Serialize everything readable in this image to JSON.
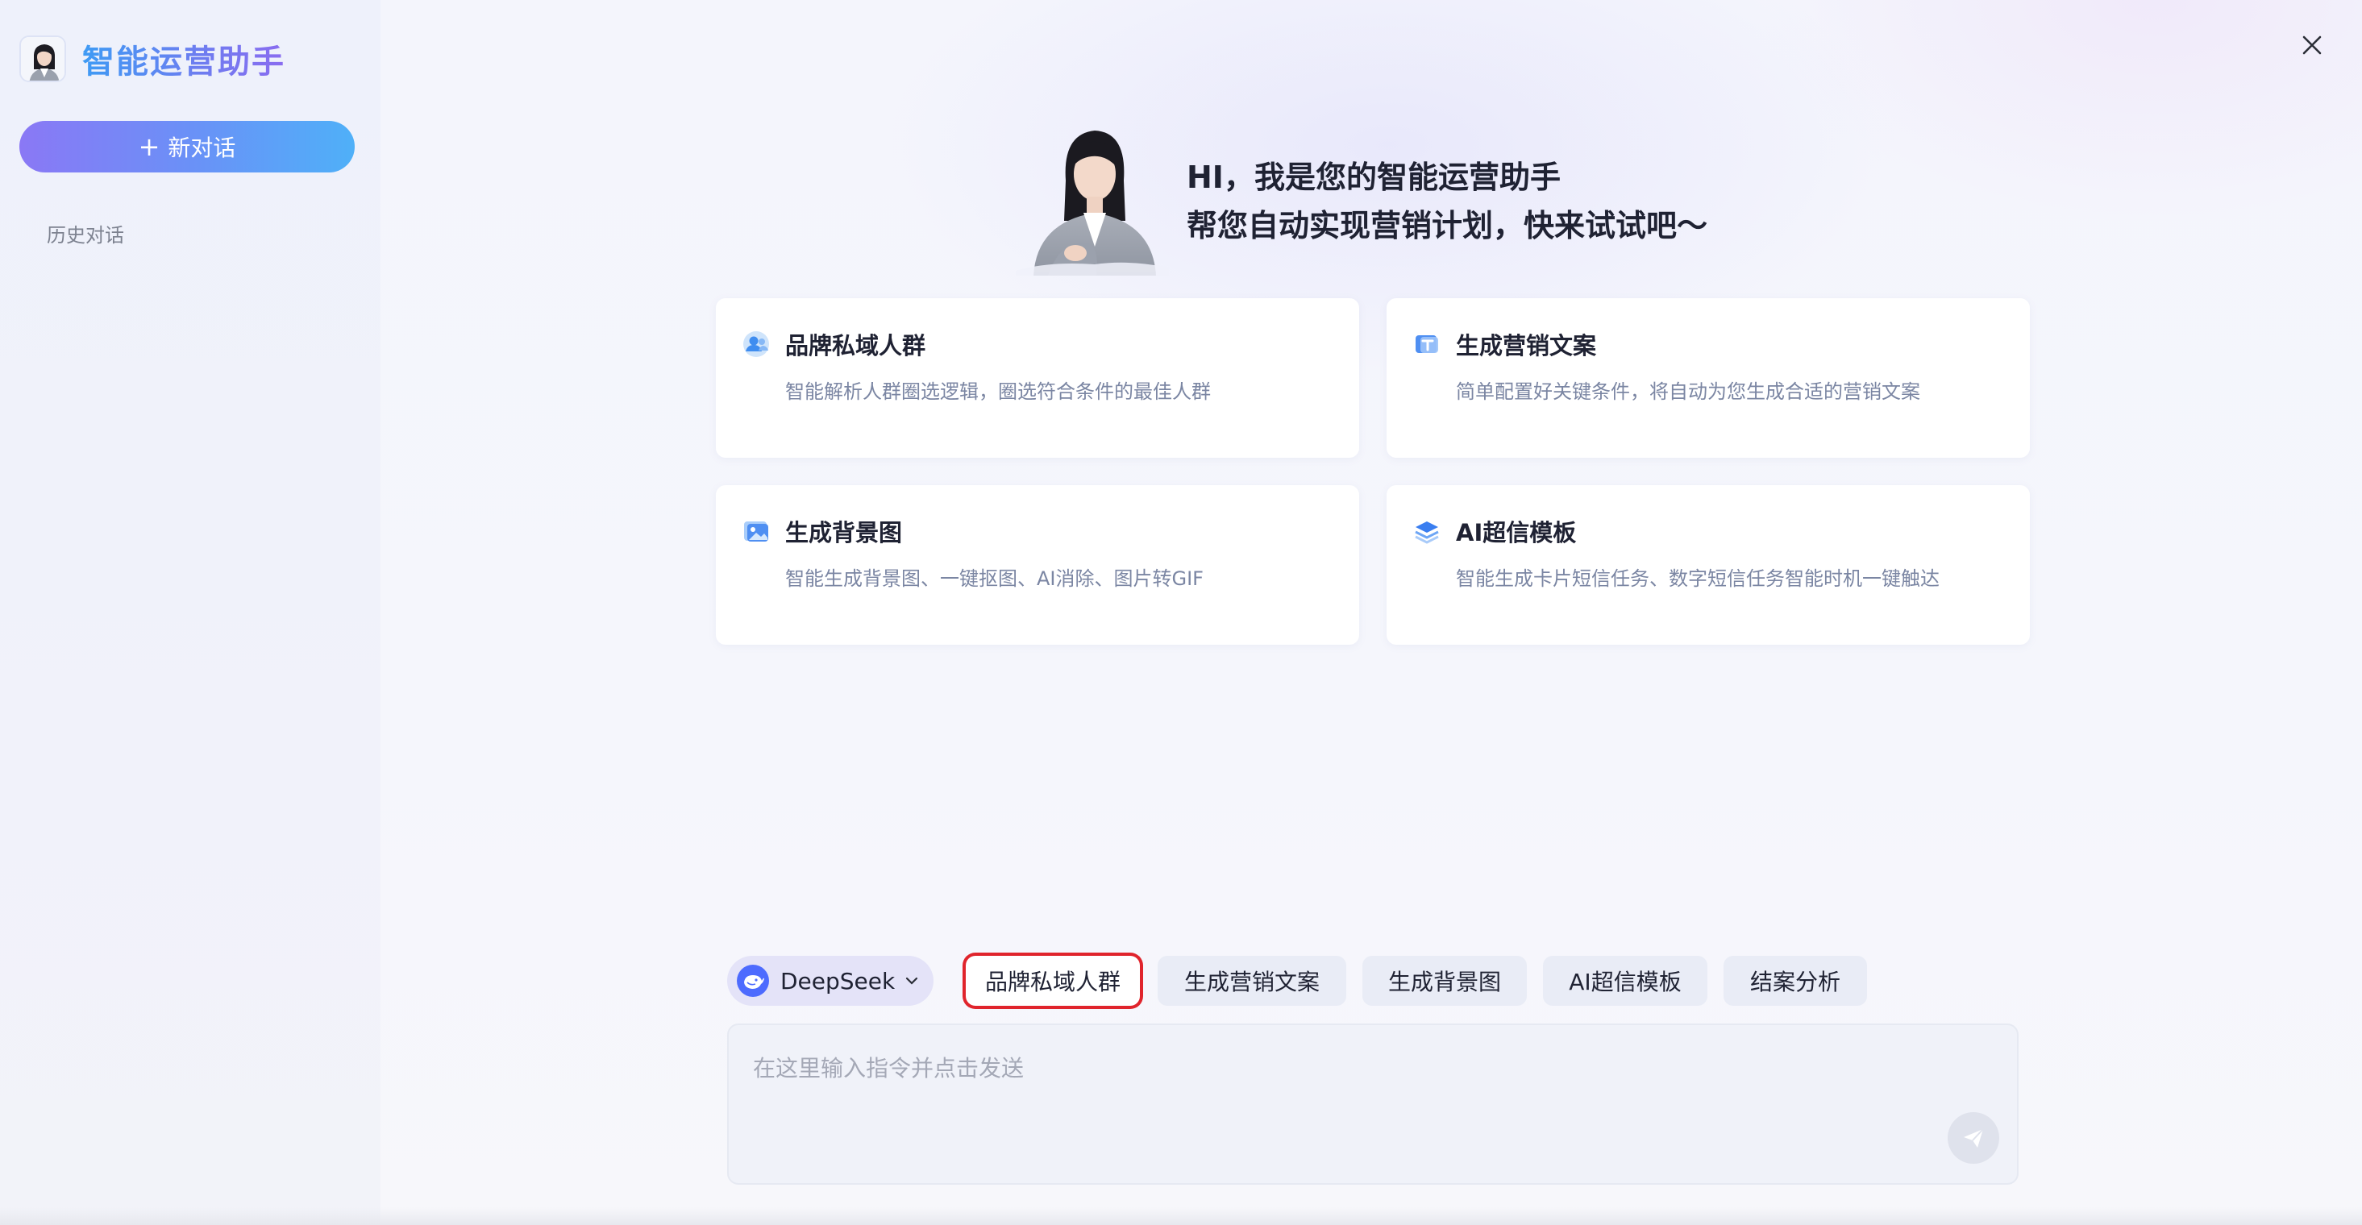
{
  "sidebar": {
    "brand_title": "智能运营助手",
    "new_chat_plus": "+",
    "new_chat_label": "新对话",
    "history_label": "历史对话"
  },
  "hero": {
    "line1": "HI，我是您的智能运营助手",
    "line2": "帮您自动实现营销计划，快来试试吧～"
  },
  "cards": [
    {
      "icon": "user-group-icon",
      "title": "品牌私域人群",
      "desc": "智能解析人群圈选逻辑，圈选符合条件的最佳人群"
    },
    {
      "icon": "text-document-icon",
      "title": "生成营销文案",
      "desc": "简单配置好关键条件，将自动为您生成合适的营销文案"
    },
    {
      "icon": "image-icon",
      "title": "生成背景图",
      "desc": "智能生成背景图、一键抠图、AI消除、图片转GIF"
    },
    {
      "icon": "layers-icon",
      "title": "AI超信模板",
      "desc": "智能生成卡片短信任务、数字短信任务智能时机一键触达"
    }
  ],
  "model_selector": {
    "name": "DeepSeek",
    "icon": "deepseek-whale-icon"
  },
  "chips": [
    {
      "label": "品牌私域人群",
      "highlighted": true
    },
    {
      "label": "生成营销文案",
      "highlighted": false
    },
    {
      "label": "生成背景图",
      "highlighted": false
    },
    {
      "label": "AI超信模板",
      "highlighted": false
    },
    {
      "label": "结案分析",
      "highlighted": false
    }
  ],
  "input": {
    "placeholder": "在这里输入指令并点击发送",
    "value": ""
  },
  "colors": {
    "accent_start": "#8a78f5",
    "accent_end": "#4fb0f8",
    "highlight_border": "#e0242c",
    "card_desc": "#7b86a3"
  }
}
